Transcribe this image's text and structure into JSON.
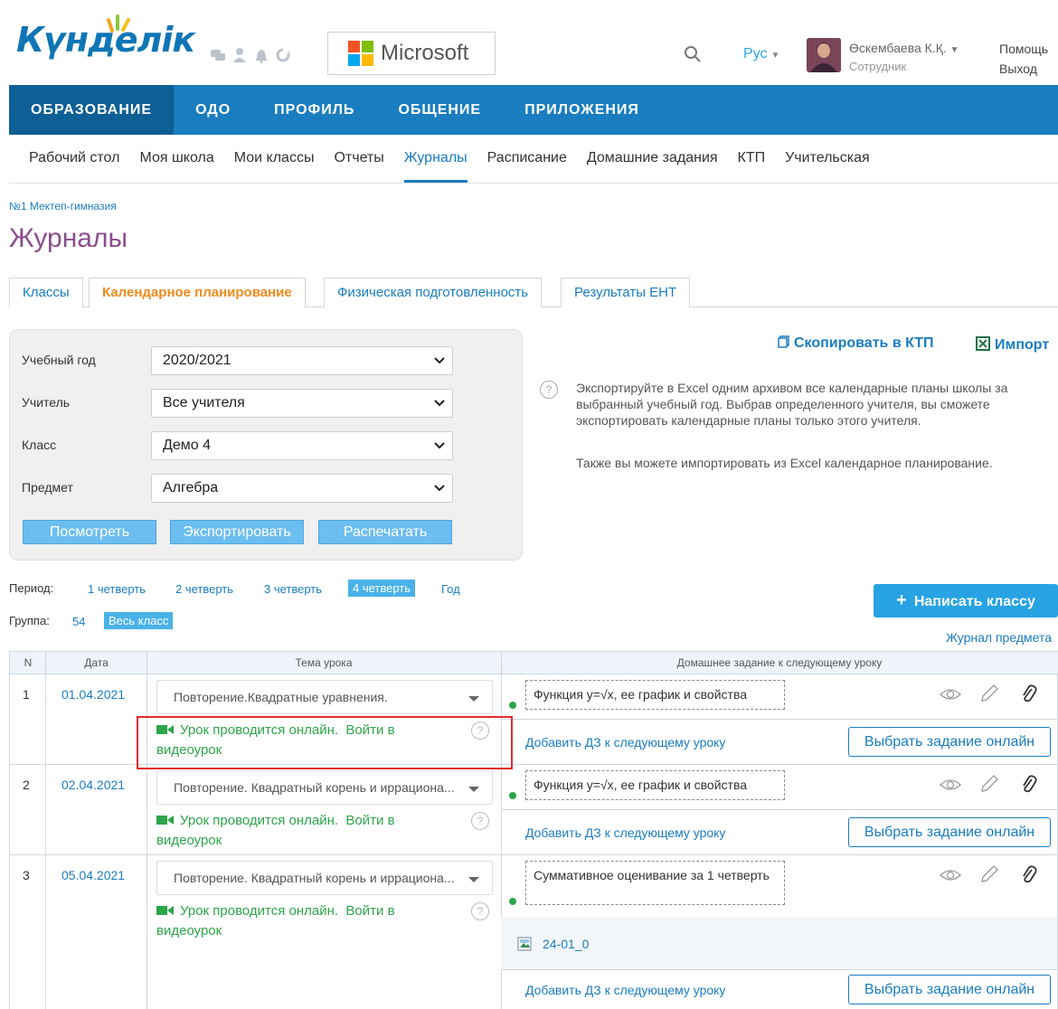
{
  "header": {
    "logo_text": "Күнделік",
    "microsoft_text": "Microsoft",
    "lang": "Рус",
    "user_name": "Өскембаева К.Қ.",
    "user_role": "Сотрудник",
    "help": "Помощь",
    "logout": "Выход",
    "icons": [
      "chat-icon",
      "user-icon",
      "bell-icon",
      "refresh-icon",
      "search-icon"
    ]
  },
  "topnav": [
    {
      "label": "ОБРАЗОВАНИЕ",
      "active": true
    },
    {
      "label": "ОДО",
      "active": false
    },
    {
      "label": "ПРОФИЛЬ",
      "active": false
    },
    {
      "label": "ОБЩЕНИЕ",
      "active": false
    },
    {
      "label": "ПРИЛОЖЕНИЯ",
      "active": false
    }
  ],
  "subnav": [
    {
      "label": "Рабочий стол"
    },
    {
      "label": "Моя школа"
    },
    {
      "label": "Мои классы"
    },
    {
      "label": "Отчеты"
    },
    {
      "label": "Журналы",
      "active": true
    },
    {
      "label": "Расписание"
    },
    {
      "label": "Домашние задания"
    },
    {
      "label": "КТП"
    },
    {
      "label": "Учительская"
    }
  ],
  "breadcrumb": "№1 Мектеп-гимназия",
  "page_title": "Журналы",
  "tabs": [
    {
      "label": "Классы"
    },
    {
      "label": "Календарное планирование",
      "active": true
    },
    {
      "label": "Физическая подготовленность"
    },
    {
      "label": "Результаты ЕНТ"
    }
  ],
  "filter": {
    "year_label": "Учебный год",
    "year_value": "2020/2021",
    "teacher_label": "Учитель",
    "teacher_value": "Все учителя",
    "class_label": "Класс",
    "class_value": "Демо 4",
    "subject_label": "Предмет",
    "subject_value": "Алгебра",
    "view_btn": "Посмотреть",
    "export_btn": "Экспортировать",
    "print_btn": "Распечатать"
  },
  "actions": {
    "copy_ktp": "Скопировать в КТП",
    "import": "Импорт"
  },
  "info": {
    "text1": "Экспортируйте в Excel одним архивом все календарные планы школы за выбранный учебный год. Выбрав определенного учителя, вы сможете экспортировать календарные планы только этого учителя.",
    "text2": "Также вы можете импортировать из Excel календарное планирование."
  },
  "period": {
    "label": "Период:",
    "items": [
      "1 четверть",
      "2 четверть",
      "3 четверть",
      "4 четверть",
      "Год"
    ],
    "active": "4 четверть"
  },
  "group": {
    "label": "Группа:",
    "count": "54",
    "active": "Весь класс"
  },
  "write_class_btn": "Написать классу",
  "journal_link": "Журнал предмета",
  "table": {
    "headers": {
      "n": "N",
      "date": "Дата",
      "topic": "Тема урока",
      "hw": "Домашнее задание к следующему уроку"
    },
    "online_text": "Урок проводится онлайн.",
    "online_link": "Войти в видеоурок",
    "add_hw": "Добавить ДЗ к следующему уроку",
    "choose_btn": "Выбрать задание онлайн",
    "rows": [
      {
        "n": "1",
        "date": "01.04.2021",
        "topic": "Повторение.Квадратные уравнения.",
        "hw": "Функция у=√x, ее график и свойства"
      },
      {
        "n": "2",
        "date": "02.04.2021",
        "topic": "Повторение. Квадратный корень и иррациона...",
        "hw": "Функция у=√x, ее график и свойства"
      },
      {
        "n": "3",
        "date": "05.04.2021",
        "topic": "Повторение. Квадратный корень и иррациона...",
        "hw": "Суммативное оценивание за 1 четверть",
        "file": "24-01_0"
      }
    ]
  }
}
